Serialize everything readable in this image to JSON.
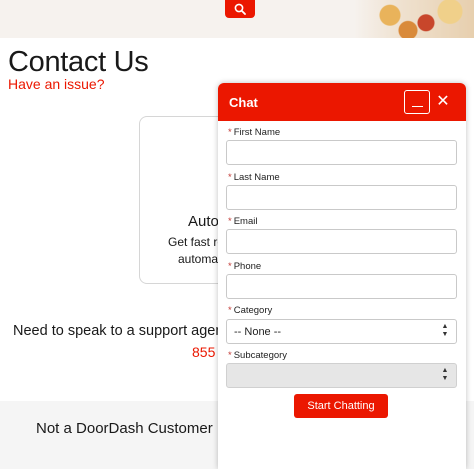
{
  "page": {
    "title": "Contact Us",
    "issue_link": "Have an issue?",
    "auto_card": {
      "title": "Auto",
      "line1": "Get fast re",
      "line2": "automa"
    },
    "agent_prompt": "Need to speak to a support agent'",
    "agent_phone": "855",
    "footer_text": "Not a DoorDash Customer"
  },
  "header": {
    "search_icon": "search-icon",
    "accent": "#eb1700"
  },
  "chat": {
    "title": "Chat",
    "minimize_icon": "minimize-icon",
    "close_icon": "close-icon",
    "close_glyph": "✕",
    "required_mark": "*",
    "fields": {
      "first_name": {
        "label": "First Name",
        "value": ""
      },
      "last_name": {
        "label": "Last Name",
        "value": ""
      },
      "email": {
        "label": "Email",
        "value": ""
      },
      "phone": {
        "label": "Phone",
        "value": ""
      },
      "category": {
        "label": "Category",
        "selected": "-- None --"
      },
      "subcategory": {
        "label": "Subcategory",
        "selected": ""
      }
    },
    "start_button": "Start Chatting"
  }
}
